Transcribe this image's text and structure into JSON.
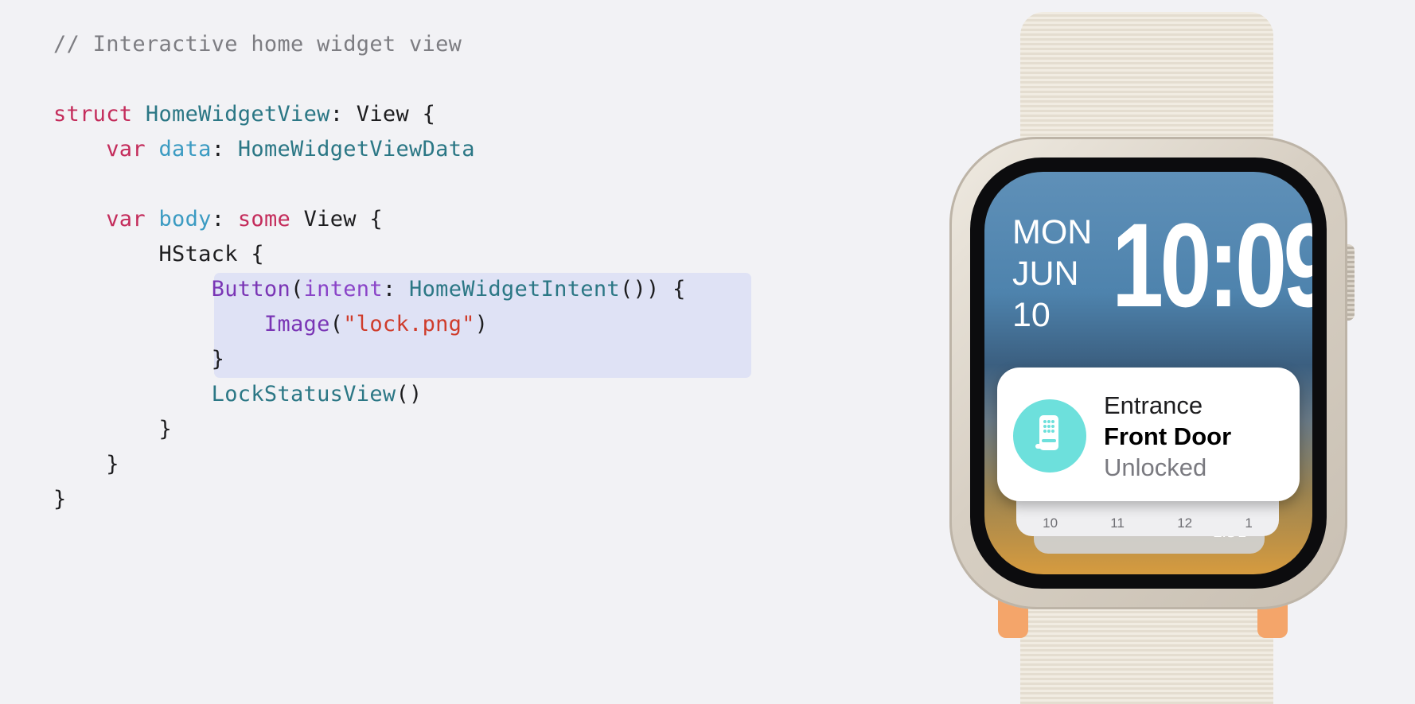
{
  "code": {
    "comment": "// Interactive home widget view",
    "l1": {
      "kw": "struct",
      "type": "HomeWidgetView",
      "rest": ": View {"
    },
    "l2": {
      "kw": "var",
      "prop": "data",
      "sep": ":",
      "type": "HomeWidgetViewData"
    },
    "l3": {
      "kw": "var",
      "prop": "body",
      "sep": ":",
      "kw2": "some",
      "rest": "View {"
    },
    "l4": "HStack {",
    "l5": {
      "fn": "Button",
      "p1": "(",
      "param": "intent",
      "p2": ":",
      "type": "HomeWidgetIntent",
      "rest": "()) {"
    },
    "l6": {
      "fn": "Image",
      "p1": "(",
      "str": "\"lock.png\"",
      "p2": ")"
    },
    "l7": "}",
    "l8": {
      "type": "LockStatusView",
      "rest": "()"
    },
    "l9": "}",
    "l10": "}",
    "l11": "}"
  },
  "watch": {
    "day": "MON",
    "month": "JUN",
    "date": "10",
    "time": "10:09",
    "card": {
      "title": "Entrance",
      "name": "Front Door",
      "status": "Unlocked"
    },
    "timeline_ticks": [
      "10",
      "11",
      "12",
      "1"
    ],
    "back_card_label": "L:51"
  },
  "colors": {
    "keyword": "#c42c5b",
    "type": "#2b7785",
    "property": "#3b9bc2",
    "function": "#7a35b5",
    "string": "#cf3c2b",
    "highlight": "#dfe2f5",
    "lock_icon_bg": "#6de0dc"
  },
  "icons": {
    "lock": "keypad-lock-icon"
  }
}
